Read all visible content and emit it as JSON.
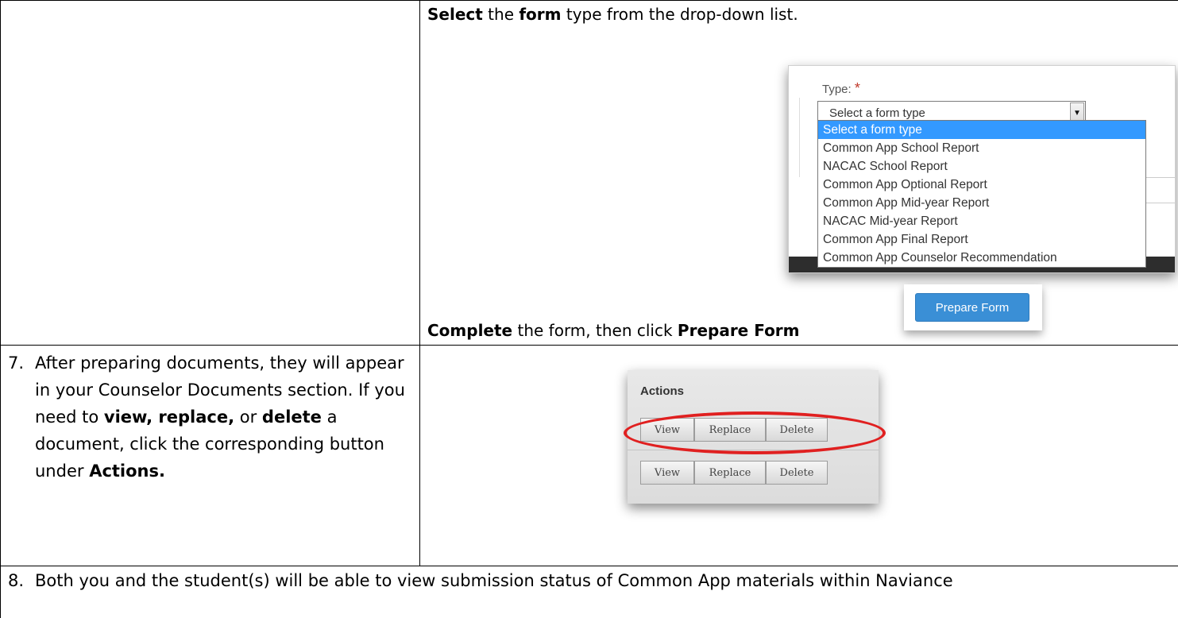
{
  "rows": {
    "select_form": {
      "instruction_parts": [
        "Select",
        " the ",
        "form",
        " type from the drop-down list."
      ],
      "complete_parts": [
        "Complete",
        " the form, then click ",
        "Prepare Form"
      ]
    },
    "step7": {
      "number": "7.",
      "text_parts": [
        "After preparing documents, they will appear in your Counselor Documents section.  If you need to ",
        "view, replace,",
        " or ",
        "delete",
        " a document, click the corresponding button under ",
        "Actions."
      ]
    },
    "step8": {
      "number": "8.",
      "text": "Both you and the student(s) will be able to view submission status of Common App materials within Naviance"
    }
  },
  "dropdown_shot": {
    "type_label": "Type:",
    "required_mark": "*",
    "selected_value": "Select a form type",
    "arrow_icon": "▼",
    "options": [
      "Select a form type",
      "Common App School Report",
      "NACAC School Report",
      "Common App Optional Report",
      "Common App Mid-year Report",
      "NACAC Mid-year Report",
      "Common App Final Report",
      "Common App Counselor Recommendation"
    ],
    "highlight_color": "#3399ff"
  },
  "prepare_shot": {
    "button_label": "Prepare Form",
    "button_color": "#3a8fd6"
  },
  "actions_shot": {
    "title": "Actions",
    "rows": [
      {
        "view": "View",
        "replace": "Replace",
        "delete": "Delete"
      },
      {
        "view": "View",
        "replace": "Replace",
        "delete": "Delete"
      }
    ],
    "highlight_color": "#e02020"
  }
}
